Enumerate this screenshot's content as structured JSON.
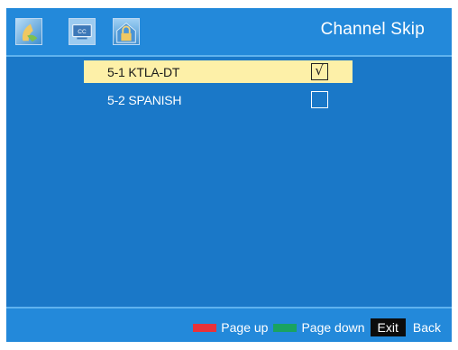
{
  "header": {
    "title": "Channel Skip",
    "tabs": [
      {
        "name": "picture-tab",
        "icon": "picture-icon"
      },
      {
        "name": "closed-caption-tab",
        "icon": "cc-icon",
        "label": "CC"
      },
      {
        "name": "lock-tab",
        "icon": "lock-icon"
      }
    ]
  },
  "channels": [
    {
      "label": "5-1  KTLA-DT",
      "skipped": true,
      "selected": true
    },
    {
      "label": "5-2  SPANISH",
      "skipped": false,
      "selected": false
    }
  ],
  "check_glyph": "√",
  "footer": {
    "page_up": {
      "label": "Page up",
      "color": "#e8323a"
    },
    "page_down": {
      "label": "Page down",
      "color": "#1aa360"
    },
    "exit_key": "Exit",
    "back": "Back"
  },
  "colors": {
    "background": "#1a78c8",
    "bar": "#2389da",
    "highlight": "#fdf0a8"
  }
}
